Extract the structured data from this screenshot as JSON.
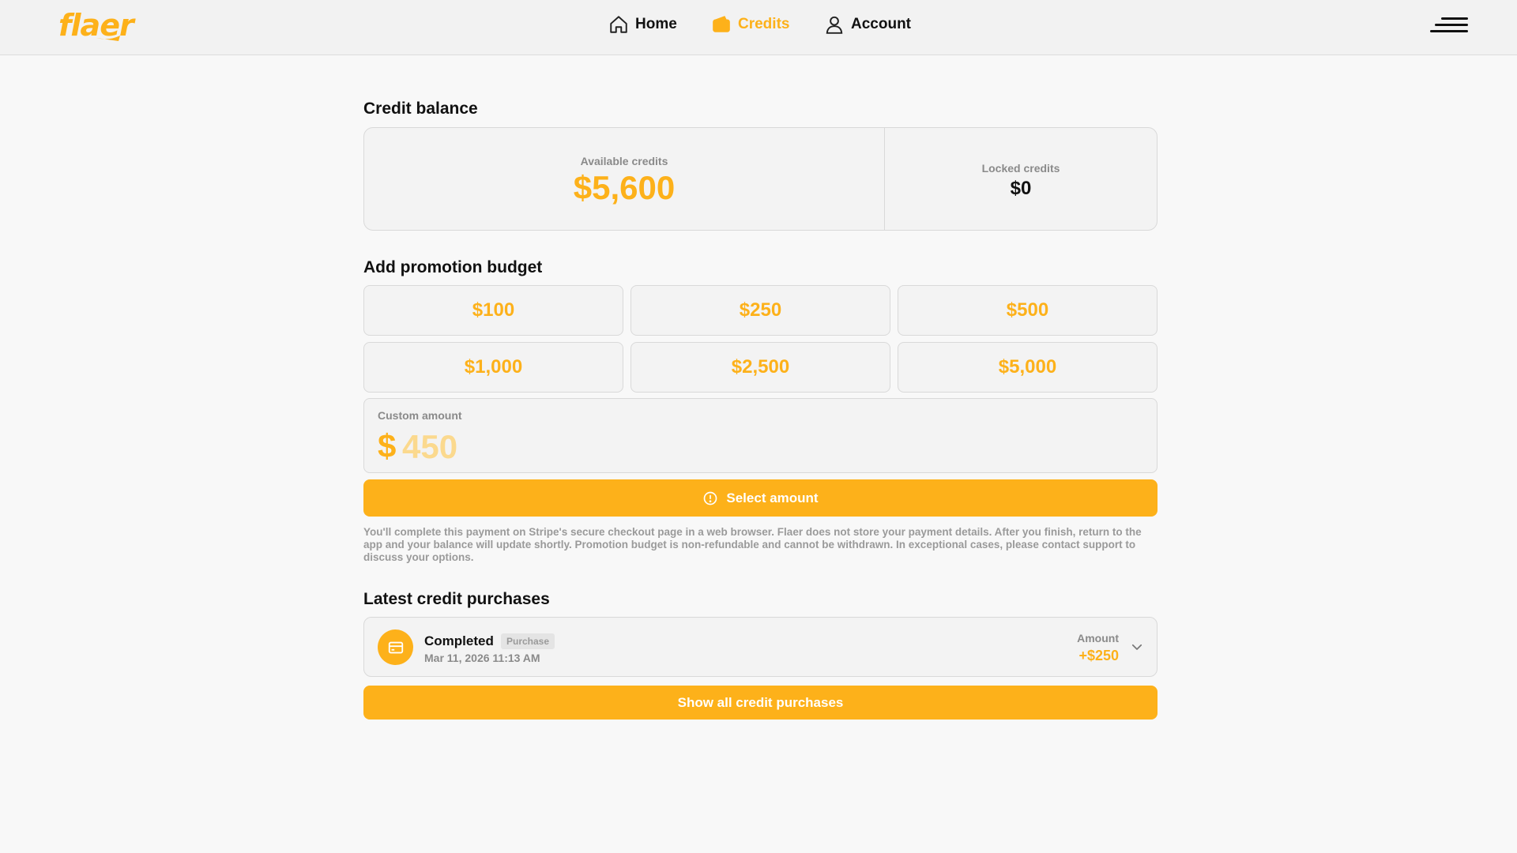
{
  "header": {
    "logo": "flaer",
    "nav": [
      {
        "label": "Home",
        "icon": "home-icon"
      },
      {
        "label": "Credits",
        "icon": "wallet-icon",
        "active": true
      },
      {
        "label": "Account",
        "icon": "user-icon"
      }
    ],
    "menu_icon": "menu-icon"
  },
  "balance": {
    "title": "Credit balance",
    "available_label": "Available credits",
    "available_value": "$5,600",
    "locked_label": "Locked credits",
    "locked_value": "$0"
  },
  "promotion": {
    "title": "Add promotion budget",
    "amounts": [
      "$100",
      "$250",
      "$500",
      "$1,000",
      "$2,500",
      "$5,000"
    ],
    "custom_label": "Custom amount",
    "currency_symbol": "$",
    "custom_placeholder": "450",
    "custom_value": "",
    "select_button": "Select amount",
    "select_icon": "alert-circle-icon",
    "disclaimer": "You'll complete this payment on Stripe's secure checkout page in a web browser. Flaer does not store your payment details. After you finish, return to the app and your balance will update shortly. Promotion budget is non-refundable and cannot be withdrawn. In exceptional cases, please contact support to discuss your options."
  },
  "purchases": {
    "title": "Latest credit purchases",
    "items": [
      {
        "status": "Completed",
        "tag": "Purchase",
        "date": "Mar 11, 2026 11:13 AM",
        "amount_label": "Amount",
        "amount": "+$250",
        "icon": "credit-card-icon"
      }
    ],
    "show_all_button": "Show all credit purchases"
  },
  "colors": {
    "accent": "#fdb11a",
    "background": "#f8f8f8",
    "card": "#f3f3f3",
    "border": "#d9d9d9",
    "muted_text": "#8a8a8a"
  }
}
